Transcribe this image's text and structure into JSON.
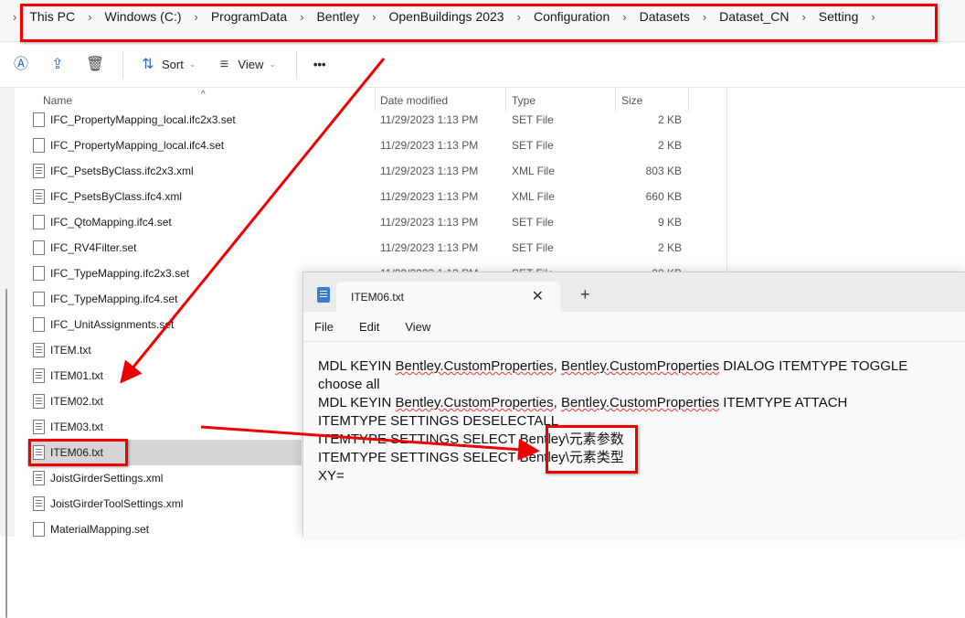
{
  "breadcrumb": [
    "This PC",
    "Windows  (C:)",
    "ProgramData",
    "Bentley",
    "OpenBuildings 2023",
    "Configuration",
    "Datasets",
    "Dataset_CN",
    "Setting"
  ],
  "toolbar": {
    "sort": "Sort",
    "view": "View",
    "more": "•••"
  },
  "columns": {
    "name": "Name",
    "date": "Date modified",
    "type": "Type",
    "size": "Size"
  },
  "files": [
    {
      "name": "IFC_PropertyMapping_local.ifc2x3.set",
      "date": "11/29/2023 1:13 PM",
      "type": "SET File",
      "size": "2 KB"
    },
    {
      "name": "IFC_PropertyMapping_local.ifc4.set",
      "date": "11/29/2023 1:13 PM",
      "type": "SET File",
      "size": "2 KB"
    },
    {
      "name": "IFC_PsetsByClass.ifc2x3.xml",
      "date": "11/29/2023 1:13 PM",
      "type": "XML File",
      "size": "803 KB"
    },
    {
      "name": "IFC_PsetsByClass.ifc4.xml",
      "date": "11/29/2023 1:13 PM",
      "type": "XML File",
      "size": "660 KB"
    },
    {
      "name": "IFC_QtoMapping.ifc4.set",
      "date": "11/29/2023 1:13 PM",
      "type": "SET File",
      "size": "9 KB"
    },
    {
      "name": "IFC_RV4Filter.set",
      "date": "11/29/2023 1:13 PM",
      "type": "SET File",
      "size": "2 KB"
    },
    {
      "name": "IFC_TypeMapping.ifc2x3.set",
      "date": "11/29/2023 1:13 PM",
      "type": "SET File",
      "size": "28 KB"
    },
    {
      "name": "IFC_TypeMapping.ifc4.set"
    },
    {
      "name": "IFC_UnitAssignments.set"
    },
    {
      "name": "ITEM.txt"
    },
    {
      "name": "ITEM01.txt"
    },
    {
      "name": "ITEM02.txt"
    },
    {
      "name": "ITEM03.txt"
    },
    {
      "name": "ITEM06.txt",
      "selected": true
    },
    {
      "name": "JoistGirderSettings.xml"
    },
    {
      "name": "JoistGirderToolSettings.xml"
    },
    {
      "name": "MaterialMapping.set"
    }
  ],
  "notepad": {
    "tab_title": "ITEM06.txt",
    "menu": [
      "File",
      "Edit",
      "View"
    ],
    "lines": [
      [
        "MDL KEYIN ",
        "Bentley.CustomProperties",
        ", ",
        "Bentley.CustomProperties",
        " DIALOG ITEMTYPE TOGGLE"
      ],
      [
        "choose all"
      ],
      [
        "MDL KEYIN ",
        "Bentley.CustomProperties",
        ", ",
        "Bentley.CustomProperties",
        " ITEMTYPE ATTACH"
      ],
      [
        "ITEMTYPE SETTINGS DESELECTALL"
      ],
      [
        "ITEMTYPE SETTINGS SELECT Bentley\\元素参数"
      ],
      [
        "ITEMTYPE SETTINGS SELECT Bentley\\元素类型"
      ],
      [
        "XY="
      ]
    ]
  },
  "annotation_color": "#e00000"
}
